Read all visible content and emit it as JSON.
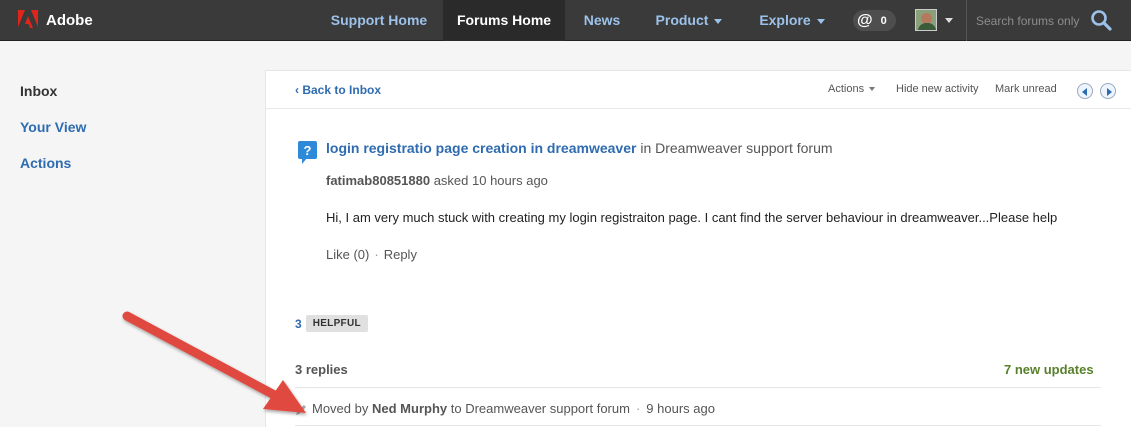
{
  "brand": {
    "name": "Adobe",
    "logo_color": "#e0251b"
  },
  "nav": {
    "items": [
      {
        "label": "Support Home"
      },
      {
        "label": "Forums Home",
        "active": true
      },
      {
        "label": "News"
      },
      {
        "label": "Product"
      },
      {
        "label": "Explore"
      }
    ],
    "mentions_count": "0",
    "search_placeholder": "Search forums only"
  },
  "sidebar": {
    "items": [
      {
        "label": "Inbox"
      },
      {
        "label": "Your View"
      },
      {
        "label": "Actions"
      }
    ]
  },
  "panel": {
    "back_label": "Back to Inbox",
    "header_actions": {
      "actions": "Actions",
      "hide_new": "Hide new activity",
      "mark_unread": "Mark unread"
    },
    "thread": {
      "title": "login registratio page creation in dreamweaver",
      "in_text": "in",
      "forum": "Dreamweaver support forum",
      "author": "fatimab80851880",
      "asked": "asked 10 hours ago",
      "body": "Hi, I am very much stuck with creating my login registraiton page. I cant find the server behaviour in dreamweaver...Please help",
      "like": "Like (0)",
      "reply": "Reply"
    },
    "helpful": {
      "count": "3",
      "label": "HELPFUL"
    },
    "replies": "3 replies",
    "new_updates": "7 new updates",
    "moved": {
      "prefix": "Moved by",
      "who": "Ned Murphy",
      "to": "to",
      "forum": "Dreamweaver support forum",
      "when": "9 hours ago"
    }
  },
  "colors": {
    "topbar": "#3a3a3a",
    "link": "#2e6bb0",
    "updates_green": "#58802b",
    "arrow_red": "#e04a3f"
  }
}
